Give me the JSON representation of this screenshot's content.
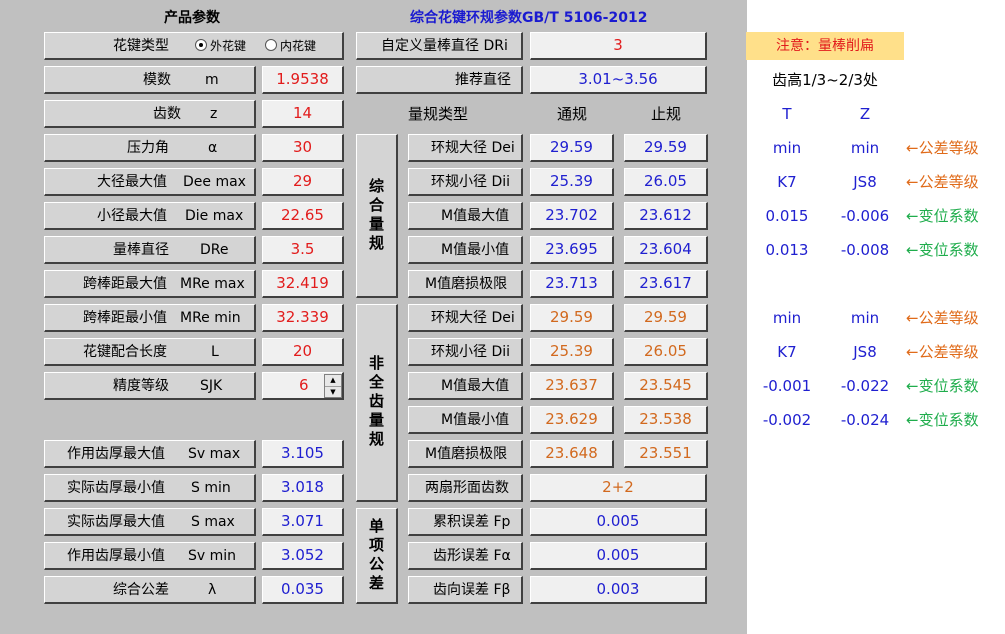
{
  "headers": {
    "left": "产品参数",
    "right": "综合花键环规参数GB/T 5106-2012"
  },
  "params": [
    {
      "name": "模数",
      "sym": "m",
      "value": "1.9538"
    },
    {
      "name": "齿数",
      "sym": "z",
      "value": "14"
    },
    {
      "name": "压力角",
      "sym": "α",
      "value": "30"
    },
    {
      "name": "大径最大值",
      "sym": "Dee max",
      "value": "29"
    },
    {
      "name": "小径最大值",
      "sym": "Die max",
      "value": "22.65"
    },
    {
      "name": "量棒直径",
      "sym": "DRe",
      "value": "3.5"
    },
    {
      "name": "跨棒距最大值",
      "sym": "MRe max",
      "value": "32.419"
    },
    {
      "name": "跨棒距最小值",
      "sym": "MRe min",
      "value": "32.339"
    },
    {
      "name": "花键配合长度",
      "sym": "L",
      "value": "20"
    },
    {
      "name": "精度等级",
      "sym": "SJK",
      "value": "6"
    }
  ],
  "spline_type": {
    "label": "花键类型",
    "options": [
      "外花键",
      "内花键"
    ],
    "selected": 0
  },
  "tolerances": [
    {
      "name": "作用齿厚最大值",
      "sym": "Sv max",
      "value": "3.105"
    },
    {
      "name": "实际齿厚最小值",
      "sym": "S min",
      "value": "3.018"
    },
    {
      "name": "实际齿厚最大值",
      "sym": "S max",
      "value": "3.071"
    },
    {
      "name": "作用齿厚最小值",
      "sym": "Sv min",
      "value": "3.052"
    },
    {
      "name": "综合公差",
      "sym": "λ",
      "value": "0.035"
    }
  ],
  "custom_dri": {
    "label": "自定义量棒直径 DRi",
    "value": "3"
  },
  "recommend": {
    "label": "推荐直径",
    "value": "3.01~3.56"
  },
  "gauge_type": {
    "label": "量规类型",
    "go": "通规",
    "nogo": "止规"
  },
  "comprehensive": {
    "title": "综合量规",
    "rows": [
      {
        "name": "环规大径 Dei",
        "go": "29.59",
        "nogo": "29.59"
      },
      {
        "name": "环规小径 Dii",
        "go": "25.39",
        "nogo": "26.05"
      },
      {
        "name": "M值最大值",
        "go": "23.702",
        "nogo": "23.612"
      },
      {
        "name": "M值最小值",
        "go": "23.695",
        "nogo": "23.604"
      },
      {
        "name": "M值磨损极限",
        "go": "23.713",
        "nogo": "23.617"
      }
    ]
  },
  "noncomplete": {
    "title": "非全齿量规",
    "rows": [
      {
        "name": "环规大径 Dei",
        "go": "29.59",
        "nogo": "29.59"
      },
      {
        "name": "环规小径 Dii",
        "go": "25.39",
        "nogo": "26.05"
      },
      {
        "name": "M值最大值",
        "go": "23.637",
        "nogo": "23.545"
      },
      {
        "name": "M值最小值",
        "go": "23.629",
        "nogo": "23.538"
      },
      {
        "name": "M值磨损极限",
        "go": "23.648",
        "nogo": "23.551"
      }
    ],
    "sector": {
      "name": "两扇形面齿数",
      "value": "2+2"
    }
  },
  "single": {
    "title": "单项公差",
    "rows": [
      {
        "name": "累积误差 Fp",
        "value": "0.005"
      },
      {
        "name": "齿形误差 Fα",
        "value": "0.005"
      },
      {
        "name": "齿向误差 Fβ",
        "value": "0.003"
      }
    ]
  },
  "side": {
    "notice": "注意：量棒削扁",
    "tooth_height": "齿高1/3~2/3处",
    "col_t": "T",
    "col_z": "Z",
    "rows1": [
      {
        "t": "min",
        "z": "min",
        "note": "←公差等级"
      },
      {
        "t": "K7",
        "z": "JS8",
        "note": "←公差等级"
      },
      {
        "t": "0.015",
        "z": "-0.006",
        "note": "←变位系数"
      },
      {
        "t": "0.013",
        "z": "-0.008",
        "note": "←变位系数"
      }
    ],
    "rows2": [
      {
        "t": "min",
        "z": "min",
        "note": "←公差等级"
      },
      {
        "t": "K7",
        "z": "JS8",
        "note": "←公差等级"
      },
      {
        "t": "-0.001",
        "z": "-0.022",
        "note": "←变位系数"
      },
      {
        "t": "-0.002",
        "z": "-0.024",
        "note": "←变位系数"
      }
    ]
  },
  "colors": {
    "panel": "#c0c0c0",
    "value_red": "#e21c1c",
    "value_blue": "#2020d0",
    "value_orange": "#d2691e",
    "arrow_orange": "#e06b1a",
    "arrow_green": "#1fad4c",
    "notice_bg": "#ffe08a"
  }
}
